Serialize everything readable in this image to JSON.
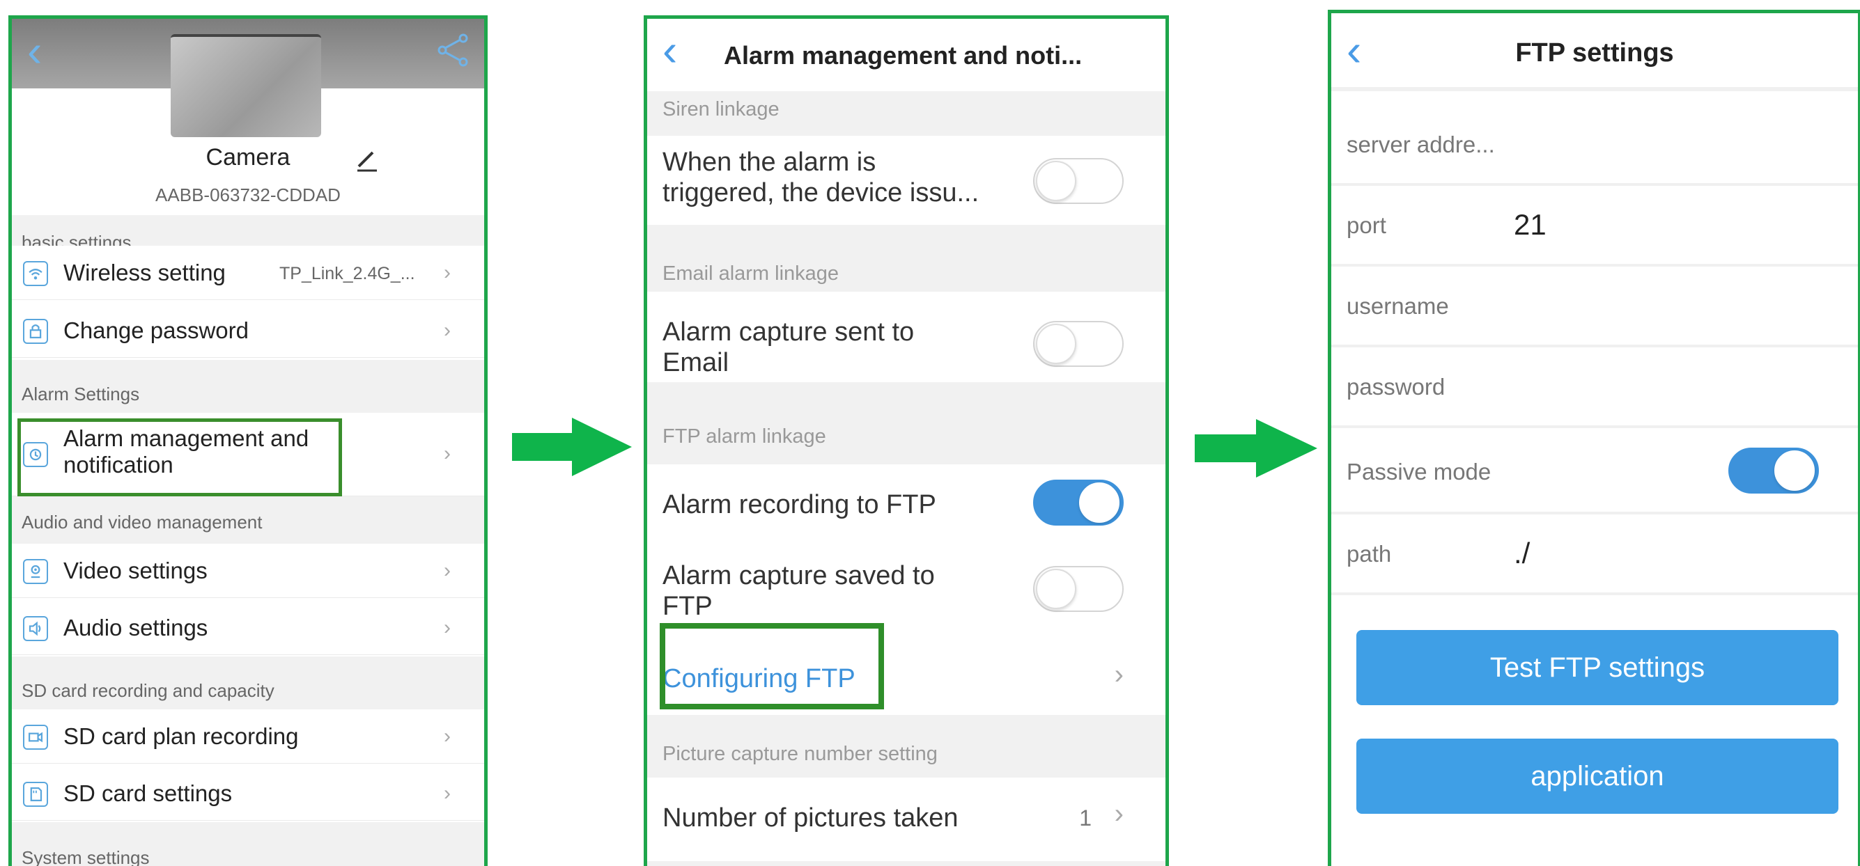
{
  "colors": {
    "accent": "#3d92db",
    "frame_green": "#1ea64b",
    "arrow_green": "#0fb44b",
    "highlight": "#3a8e2c"
  },
  "panel1": {
    "device_name": "Camera",
    "device_uid": "AABB-063732-CDDAD",
    "sections": {
      "basic": "basic settings",
      "alarm": "Alarm Settings",
      "av": "Audio and video management",
      "sd": "SD card recording and capacity",
      "system": "System settings"
    },
    "items": {
      "wireless": {
        "label": "Wireless setting",
        "value": "TP_Link_2.4G_...",
        "icon": "wifi-icon"
      },
      "password": {
        "label": "Change password",
        "icon": "lock-icon"
      },
      "alarm": {
        "label_1": "Alarm management and",
        "label_2": "notification",
        "icon": "alarm-icon"
      },
      "video": {
        "label": "Video settings",
        "icon": "camera-icon"
      },
      "audio": {
        "label": "Audio settings",
        "icon": "speaker-icon"
      },
      "sd_plan": {
        "label": "SD card plan recording",
        "icon": "record-icon"
      },
      "sd_settings": {
        "label": "SD card settings",
        "icon": "sd-card-icon"
      }
    }
  },
  "panel2": {
    "title": "Alarm management and noti...",
    "siren_section": "Siren linkage",
    "siren_label_1": "When the alarm is",
    "siren_label_2": "triggered, the device issu...",
    "siren_on": false,
    "email_section": "Email alarm linkage",
    "email_label_1": "Alarm capture sent to",
    "email_label_2": "Email",
    "email_on": false,
    "ftp_section": "FTP alarm linkage",
    "ftp_record_label": "Alarm recording to FTP",
    "ftp_record_on": true,
    "ftp_capture_label_1": "Alarm capture saved to",
    "ftp_capture_label_2": "FTP",
    "ftp_capture_on": false,
    "configure_label": "Configuring FTP",
    "picture_section": "Picture capture number setting",
    "pictures_label": "Number of pictures taken",
    "pictures_value": "1"
  },
  "panel3": {
    "title": "FTP settings",
    "server_label": "server addre...",
    "port_label": "port",
    "port_value": "21",
    "username_label": "username",
    "password_label": "password",
    "passive_label": "Passive mode",
    "passive_on": true,
    "path_label": "path",
    "path_value": "./",
    "test_button": "Test FTP settings",
    "apply_button": "application"
  }
}
